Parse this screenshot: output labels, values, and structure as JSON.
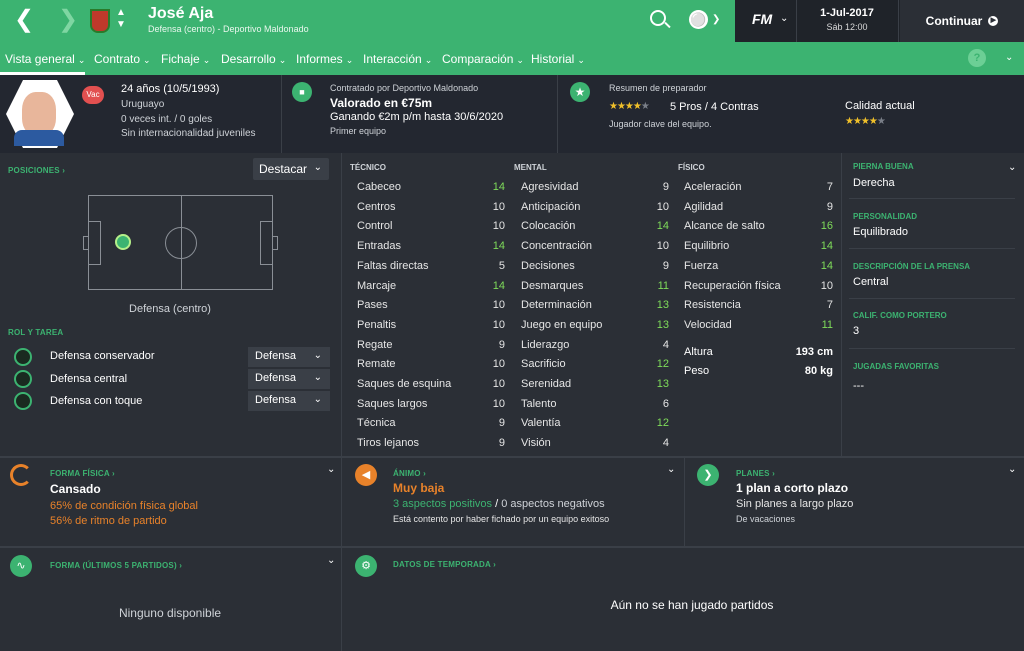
{
  "header": {
    "name": "José Aja",
    "subtitle": "Defensa (centro) - Deportivo Maldonado",
    "date": "1-Jul-2017",
    "date_sub": "Sáb 12:00",
    "continue_label": "Continuar",
    "fm_logo": "FM"
  },
  "menu": [
    "Vista general",
    "Contrato",
    "Fichaje",
    "Desarrollo",
    "Informes",
    "Interacción",
    "Comparación",
    "Historial"
  ],
  "profile": {
    "badge": "Vac",
    "age": "24 años (10/5/1993)",
    "nationality": "Uruguayo",
    "caps": "0 veces int. / 0 goles",
    "youth": "Sin internacionalidad juveniles"
  },
  "contract": {
    "by": "Contratado por Deportivo Maldonado",
    "value": "Valorado en €75m",
    "wage": "Ganando €2m p/m hasta 30/6/2020",
    "squad": "Primer equipo"
  },
  "coach": {
    "title": "Resumen de preparador",
    "pros": "5 Pros / 4 Contras",
    "note": "Jugador clave del equipo.",
    "quality_label": "Calidad actual",
    "stars_summary": 3.5,
    "stars_quality": 3.5
  },
  "positions": {
    "title": "POSICIONES",
    "highlight": "Destacar",
    "position_name": "Defensa (centro)"
  },
  "roles": {
    "title": "ROL Y TAREA",
    "items": [
      {
        "role": "Defensa conservador",
        "duty": "Defensa"
      },
      {
        "role": "Defensa central",
        "duty": "Defensa"
      },
      {
        "role": "Defensa con toque",
        "duty": "Defensa"
      }
    ]
  },
  "attributes": {
    "tecnico_title": "TÉCNICO",
    "mental_title": "MENTAL",
    "fisico_title": "FÍSICO",
    "tecnico": [
      [
        "Cabeceo",
        14
      ],
      [
        "Centros",
        10
      ],
      [
        "Control",
        10
      ],
      [
        "Entradas",
        14
      ],
      [
        "Faltas directas",
        5
      ],
      [
        "Marcaje",
        14
      ],
      [
        "Pases",
        10
      ],
      [
        "Penaltis",
        10
      ],
      [
        "Regate",
        9
      ],
      [
        "Remate",
        10
      ],
      [
        "Saques de esquina",
        10
      ],
      [
        "Saques largos",
        10
      ],
      [
        "Técnica",
        9
      ],
      [
        "Tiros lejanos",
        9
      ]
    ],
    "mental": [
      [
        "Agresividad",
        9
      ],
      [
        "Anticipación",
        10
      ],
      [
        "Colocación",
        14
      ],
      [
        "Concentración",
        10
      ],
      [
        "Decisiones",
        9
      ],
      [
        "Desmarques",
        11
      ],
      [
        "Determinación",
        13
      ],
      [
        "Juego en equipo",
        13
      ],
      [
        "Liderazgo",
        4
      ],
      [
        "Sacrificio",
        12
      ],
      [
        "Serenidad",
        13
      ],
      [
        "Talento",
        6
      ],
      [
        "Valentía",
        12
      ],
      [
        "Visión",
        4
      ]
    ],
    "fisico": [
      [
        "Aceleración",
        7
      ],
      [
        "Agilidad",
        9
      ],
      [
        "Alcance de salto",
        16
      ],
      [
        "Equilibrio",
        14
      ],
      [
        "Fuerza",
        14
      ],
      [
        "Recuperación física",
        10
      ],
      [
        "Resistencia",
        7
      ],
      [
        "Velocidad",
        11
      ]
    ],
    "height_label": "Altura",
    "height": "193 cm",
    "weight_label": "Peso",
    "weight": "80 kg"
  },
  "side": {
    "foot_label": "PIERNA BUENA",
    "foot": "Derecha",
    "personality_label": "PERSONALIDAD",
    "personality": "Equilibrado",
    "press_label": "DESCRIPCIÓN DE LA PRENSA",
    "press": "Central",
    "gk_label": "CALIF. COMO PORTERO",
    "gk": "3",
    "moves_label": "JUGADAS FAVORITAS",
    "moves": "---"
  },
  "fitness": {
    "title": "FORMA FÍSICA",
    "status": "Cansado",
    "line1": "65% de condición física global",
    "line2": "56% de ritmo de partido"
  },
  "morale": {
    "title": "ÁNIMO",
    "status": "Muy baja",
    "pos": "3 aspectos positivos",
    "sep": "/",
    "neg": "0 aspectos negativos",
    "note": "Está contento por haber fichado por un equipo exitoso"
  },
  "plans": {
    "title": "PLANES",
    "status": "1 plan a corto plazo",
    "line1": "Sin planes a largo plazo",
    "line2": "De vacaciones"
  },
  "form": {
    "title": "FORMA (ÚLTIMOS 5 PARTIDOS)",
    "empty": "Ninguno disponible"
  },
  "season": {
    "title": "DATOS DE TEMPORADA",
    "empty": "Aún no se han jugado partidos"
  },
  "colors": {
    "accent": "#3cb371",
    "bg": "#2b2f36",
    "panel": "#232730",
    "orange": "#e8822a",
    "attr_green": "#7fdc5a"
  }
}
